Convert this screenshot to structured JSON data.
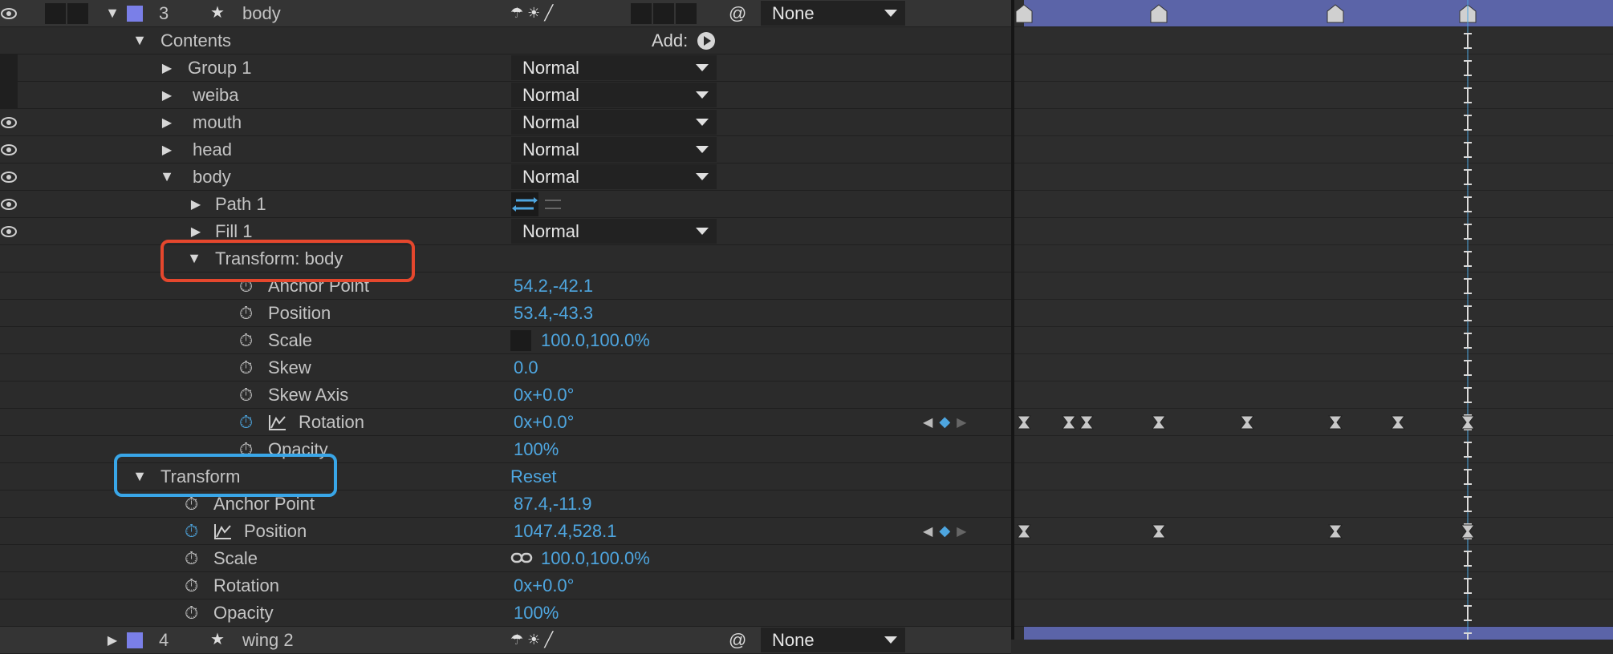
{
  "layer_top": {
    "number": "3",
    "name": "body",
    "mode": "None"
  },
  "contents": {
    "label": "Contents",
    "add_label": "Add:"
  },
  "groups": [
    {
      "name": "Group 1",
      "mode": "Normal"
    },
    {
      "name": "weiba",
      "mode": "Normal"
    },
    {
      "name": "mouth",
      "mode": "Normal"
    },
    {
      "name": "head",
      "mode": "Normal"
    },
    {
      "name": "body",
      "mode": "Normal"
    }
  ],
  "body_children": {
    "path": "Path 1",
    "fill": "Fill 1",
    "fill_mode": "Normal"
  },
  "group_transform": {
    "label": "Transform:  body",
    "properties": [
      {
        "name": "Anchor Point",
        "value": "54.2,-42.1"
      },
      {
        "name": "Position",
        "value": "53.4,-43.3"
      },
      {
        "name": "Scale",
        "value": "100.0,100.0%"
      },
      {
        "name": "Skew",
        "value": "0.0"
      },
      {
        "name": "Skew Axis",
        "value": "0x+0.0°"
      },
      {
        "name": "Rotation",
        "value": "0x+0.0°"
      },
      {
        "name": "Opacity",
        "value": "100%"
      }
    ]
  },
  "layer_transform": {
    "label": "Transform",
    "reset_label": "Reset",
    "properties": [
      {
        "name": "Anchor Point",
        "value": "87.4,-11.9"
      },
      {
        "name": "Position",
        "value": "1047.4,528.1"
      },
      {
        "name": "Scale",
        "value": "100.0,100.0%"
      },
      {
        "name": "Rotation",
        "value": "0x+0.0°"
      },
      {
        "name": "Opacity",
        "value": "100%"
      }
    ]
  },
  "layer_bottom": {
    "number": "4",
    "name": "wing 2",
    "mode": "None"
  },
  "colors": {
    "label_swatch": "#7a7fe8",
    "accent_blue": "#4ea6e0",
    "layer_bar": "#5b64a8",
    "highlight_red": "#e5472d",
    "highlight_blue": "#39a6e8"
  }
}
